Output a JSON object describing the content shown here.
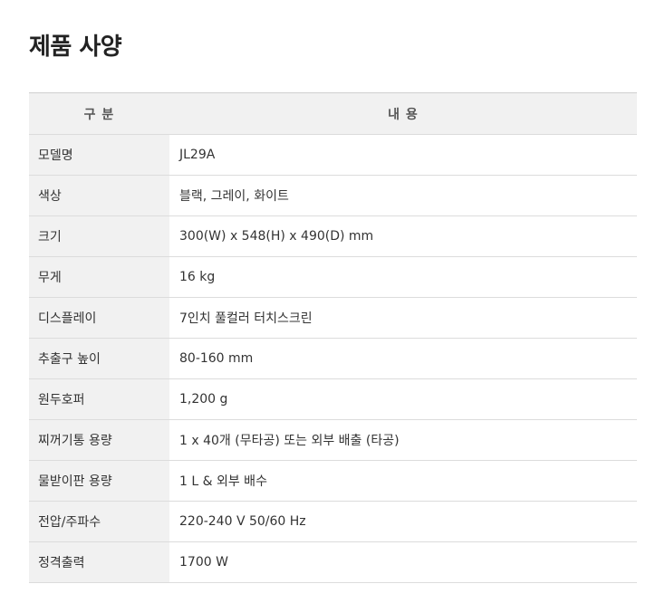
{
  "page": {
    "title": "제품 사양"
  },
  "table": {
    "headers": {
      "category": "구 분",
      "content": "내 용"
    },
    "rows": [
      {
        "label": "모델명",
        "value": "JL29A"
      },
      {
        "label": "색상",
        "value": "블랙, 그레이, 화이트"
      },
      {
        "label": "크기",
        "value": "300(W) x 548(H) x 490(D) mm"
      },
      {
        "label": "무게",
        "value": "16 kg"
      },
      {
        "label": "디스플레이",
        "value": "7인치 풀컬러 터치스크린"
      },
      {
        "label": "추출구 높이",
        "value": "80-160 mm"
      },
      {
        "label": "원두호퍼",
        "value": "1,200 g"
      },
      {
        "label": "찌꺼기통 용량",
        "value": "1 x 40개 (무타공) 또는 외부 배출 (타공)"
      },
      {
        "label": "물받이판 용량",
        "value": "1 L & 외부 배수"
      },
      {
        "label": "전압/주파수",
        "value": "220-240 V 50/60 Hz"
      },
      {
        "label": "정격출력",
        "value": "1700 W"
      }
    ]
  }
}
